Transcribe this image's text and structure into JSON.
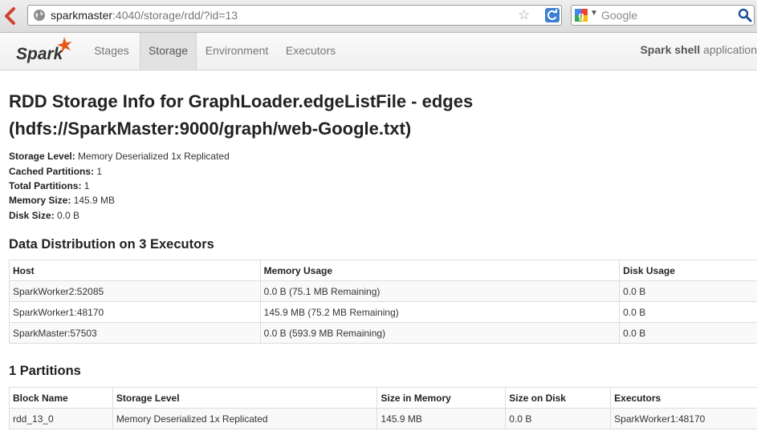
{
  "browser": {
    "url_host": "sparkmaster",
    "url_rest": ":4040/storage/rdd/?id=13",
    "search_placeholder": "Google"
  },
  "nav": {
    "logo_text": "Spark",
    "tabs": [
      "Stages",
      "Storage",
      "Environment",
      "Executors"
    ],
    "active_tab": "Storage",
    "app_name": "Spark shell",
    "app_suffix": " application"
  },
  "page": {
    "title": "RDD Storage Info for GraphLoader.edgeListFile - edges (hdfs://SparkMaster:9000/graph/web-Google.txt)"
  },
  "summary": [
    {
      "label": "Storage Level:",
      "value": " Memory Deserialized 1x Replicated"
    },
    {
      "label": "Cached Partitions:",
      "value": " 1"
    },
    {
      "label": "Total Partitions:",
      "value": " 1"
    },
    {
      "label": "Memory Size:",
      "value": " 145.9 MB"
    },
    {
      "label": "Disk Size:",
      "value": " 0.0 B"
    }
  ],
  "distribution": {
    "title": "Data Distribution on 3 Executors",
    "headers": [
      "Host",
      "Memory Usage",
      "Disk Usage"
    ],
    "rows": [
      [
        "SparkWorker2:52085",
        "0.0 B (75.1 MB Remaining)",
        "0.0 B"
      ],
      [
        "SparkWorker1:48170",
        "145.9 MB (75.2 MB Remaining)",
        "0.0 B"
      ],
      [
        "SparkMaster:57503",
        "0.0 B (593.9 MB Remaining)",
        "0.0 B"
      ]
    ]
  },
  "partitions": {
    "title": "1 Partitions",
    "headers": [
      "Block Name",
      "Storage Level",
      "Size in Memory",
      "Size on Disk",
      "Executors"
    ],
    "rows": [
      [
        "rdd_13_0",
        "Memory Deserialized 1x Replicated",
        "145.9 MB",
        "0.0 B",
        "SparkWorker1:48170"
      ]
    ]
  }
}
